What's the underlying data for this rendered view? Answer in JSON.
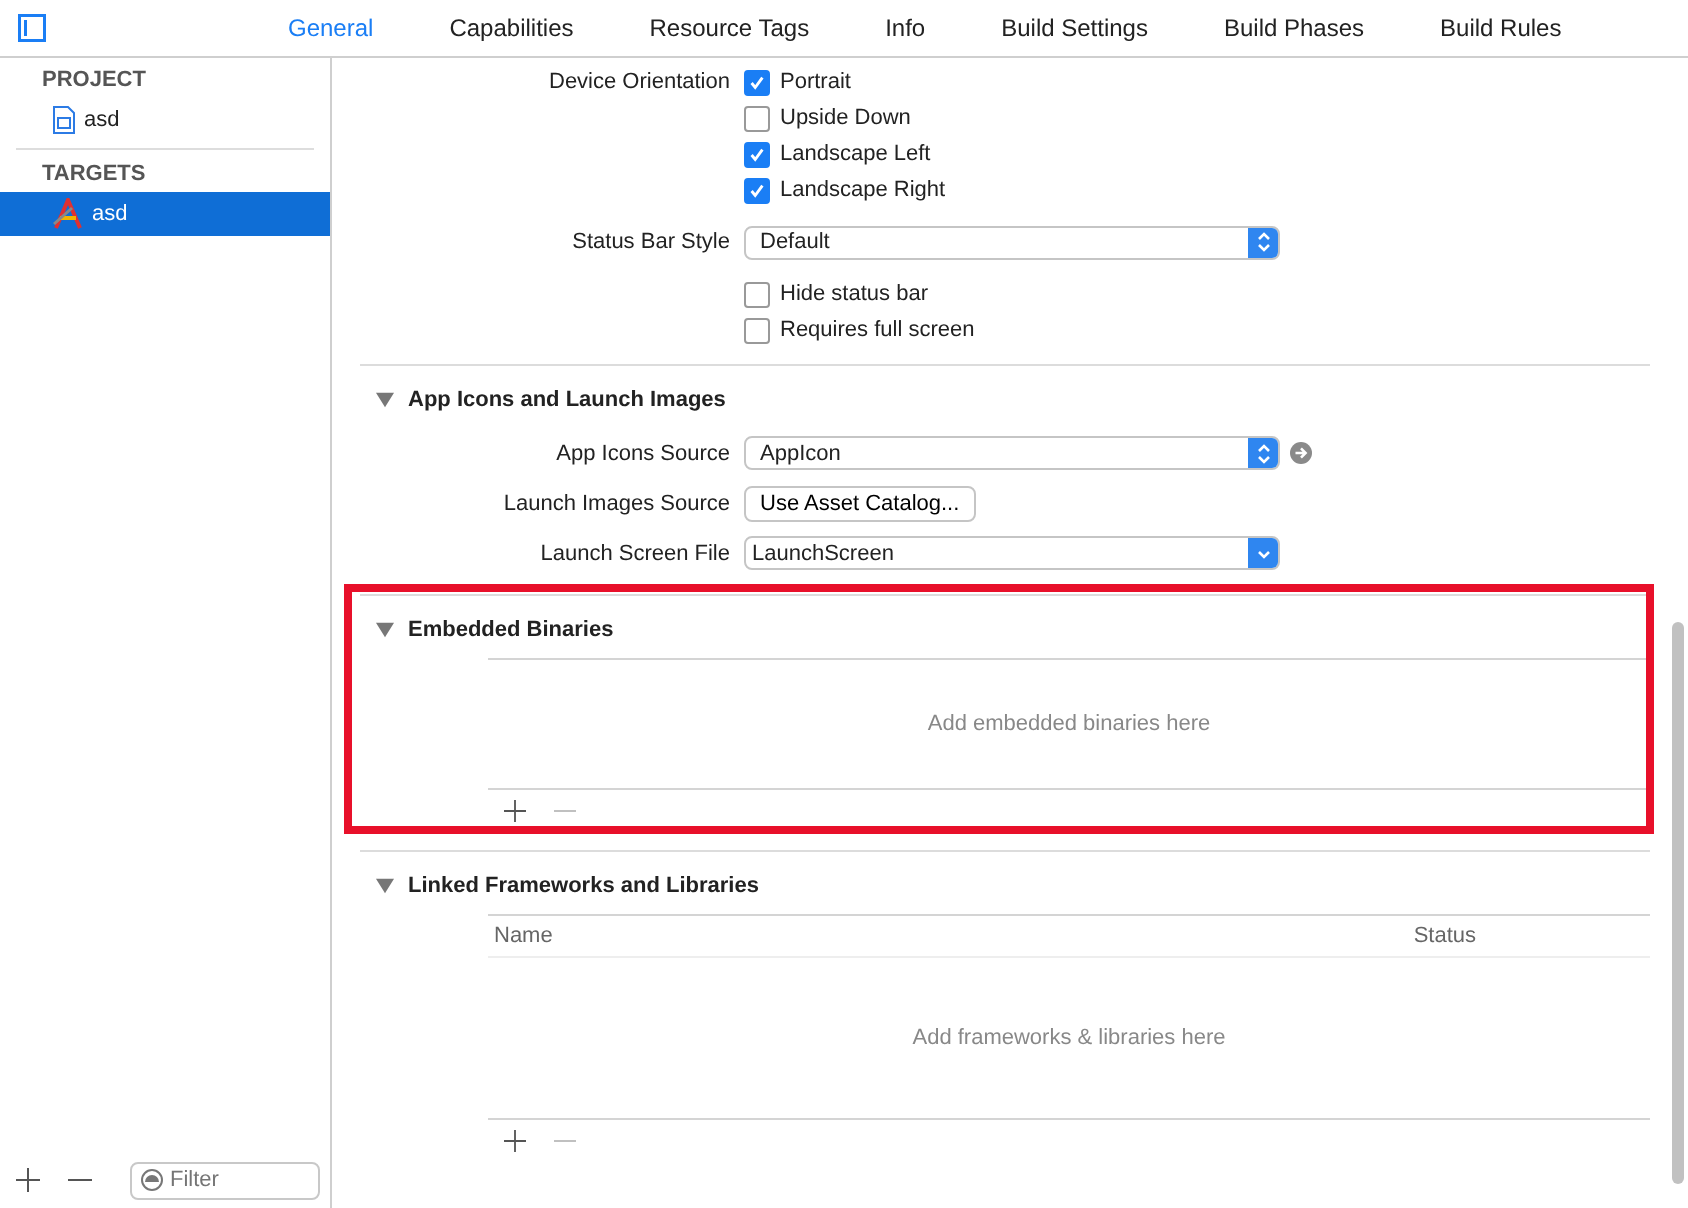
{
  "tabs": [
    {
      "label": "General",
      "selected": true
    },
    {
      "label": "Capabilities",
      "selected": false
    },
    {
      "label": "Resource Tags",
      "selected": false
    },
    {
      "label": "Info",
      "selected": false
    },
    {
      "label": "Build Settings",
      "selected": false
    },
    {
      "label": "Build Phases",
      "selected": false
    },
    {
      "label": "Build Rules",
      "selected": false
    }
  ],
  "sidebar": {
    "groups": [
      {
        "title": "PROJECT",
        "items": [
          {
            "label": "asd",
            "kind": "project",
            "selected": false
          }
        ]
      },
      {
        "title": "TARGETS",
        "items": [
          {
            "label": "asd",
            "kind": "target",
            "selected": true
          }
        ]
      }
    ],
    "filter": {
      "placeholder": "Filter"
    }
  },
  "deployment": {
    "orientation_label": "Device Orientation",
    "orientations": [
      {
        "label": "Portrait",
        "checked": true
      },
      {
        "label": "Upside Down",
        "checked": false
      },
      {
        "label": "Landscape Left",
        "checked": true
      },
      {
        "label": "Landscape Right",
        "checked": true
      }
    ],
    "status_bar_style_label": "Status Bar Style",
    "status_bar_style": "Default",
    "options": [
      {
        "label": "Hide status bar",
        "checked": false
      },
      {
        "label": "Requires full screen",
        "checked": false
      }
    ]
  },
  "app_icons": {
    "title": "App Icons and Launch Images",
    "expanded": true,
    "rows": [
      {
        "label": "App Icons Source",
        "kind": "popup",
        "value": "AppIcon",
        "arrow": true
      },
      {
        "label": "Launch Images Source",
        "kind": "button",
        "value": "Use Asset Catalog..."
      },
      {
        "label": "Launch Screen File",
        "kind": "combo",
        "value": "LaunchScreen"
      }
    ]
  },
  "embedded": {
    "title": "Embedded Binaries",
    "expanded": true,
    "highlighted": true,
    "empty_text": "Add embedded binaries here"
  },
  "linked": {
    "title": "Linked Frameworks and Libraries",
    "expanded": true,
    "columns": [
      "Name",
      "Status"
    ],
    "empty_text": "Add frameworks & libraries here"
  }
}
